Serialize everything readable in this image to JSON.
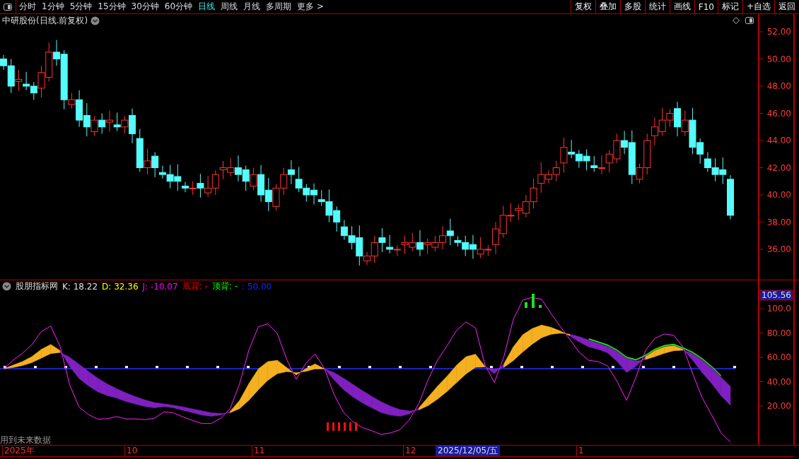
{
  "toolbar": {
    "periods": [
      {
        "label": "分时",
        "selected": false
      },
      {
        "label": "1分钟",
        "selected": false
      },
      {
        "label": "5分钟",
        "selected": false
      },
      {
        "label": "15分钟",
        "selected": false
      },
      {
        "label": "30分钟",
        "selected": false
      },
      {
        "label": "60分钟",
        "selected": false
      },
      {
        "label": "日线",
        "selected": true
      },
      {
        "label": "周线",
        "selected": false
      },
      {
        "label": "月线",
        "selected": false
      },
      {
        "label": "多周期",
        "selected": false
      },
      {
        "label": "更多 >",
        "selected": false
      }
    ],
    "actions": [
      "复权",
      "叠加",
      "多股",
      "统计",
      "画线",
      "F10",
      "标记",
      "+自选",
      "返回"
    ]
  },
  "chart": {
    "title": "中研股份(日线.前复权)",
    "price_axis": [
      "52.00",
      "50.00",
      "48.00",
      "46.00",
      "44.00",
      "42.00",
      "40.00",
      "38.00",
      "36.00"
    ]
  },
  "indicator": {
    "name": "股朋指标网",
    "readings": [
      {
        "text": "K: 18.22",
        "kind": "k"
      },
      {
        "text": "D: 32.36",
        "kind": "d"
      },
      {
        "text": "J: -10.07",
        "kind": "j"
      },
      {
        "text": "底背: -",
        "kind": "bottom"
      },
      {
        "text": "顶背: -",
        "kind": "top"
      },
      {
        "text": ": 50.00",
        "kind": "reference"
      }
    ],
    "cursor_value": "105.56",
    "axis": [
      "100.0",
      "80.00",
      "60.00",
      "40.00",
      "20.00"
    ],
    "note": "用到未来数据"
  },
  "date_axis": [
    {
      "label": "2025年",
      "kind": "tick"
    },
    {
      "label": "10",
      "kind": "tick"
    },
    {
      "label": "11",
      "kind": "tick"
    },
    {
      "label": "12",
      "kind": "tick"
    },
    {
      "label": "2025/12/05/五",
      "kind": "cursor"
    },
    {
      "label": "1",
      "kind": "tick"
    }
  ]
}
